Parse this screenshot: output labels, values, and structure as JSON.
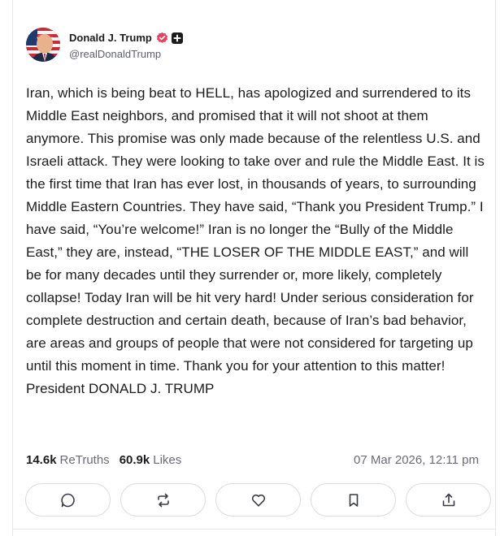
{
  "post": {
    "author": {
      "display_name": "Donald J. Trump",
      "handle": "@realDonaldTrump",
      "avatar_icon": "avatar-portrait-flag",
      "verified_icon": "verified-badge-icon",
      "verified_color": "#e8425c",
      "plus_icon": "plus-badge-icon"
    },
    "text": "Iran, which is being beat to HELL, has apologized and surrendered to its Middle East neighbors, and promised that it will not shoot at them anymore. This promise was only made because of the relentless U.S. and Israeli attack. They were looking to take over and rule the Middle East. It is the first time that Iran has ever lost, in thousands of years, to surrounding Middle Eastern Countries. They have said, “Thank you President Trump.” I have said, “You’re welcome!” Iran is no longer the “Bully of the Middle East,” they are, instead, “THE LOSER OF THE MIDDLE EAST,” and will be for many decades until they surrender or, more likely, completely collapse! Today Iran will be hit very hard! Under serious consideration for complete destruction and certain death, because of Iran’s bad behavior, are areas and groups of people that were not considered for targeting up until this moment in time. Thank you for your attention to this matter! President DONALD J. TRUMP",
    "stats": {
      "retruths_count": "14.6k",
      "retruths_label": "ReTruths",
      "likes_count": "60.9k",
      "likes_label": "Likes"
    },
    "timestamp": "07 Mar 2026, 12:11 pm",
    "actions": [
      {
        "name": "reply-button",
        "icon": "comment-icon"
      },
      {
        "name": "retruth-button",
        "icon": "repost-icon"
      },
      {
        "name": "like-button",
        "icon": "heart-icon"
      },
      {
        "name": "bookmark-button",
        "icon": "bookmark-icon"
      },
      {
        "name": "share-button",
        "icon": "share-icon"
      }
    ]
  }
}
